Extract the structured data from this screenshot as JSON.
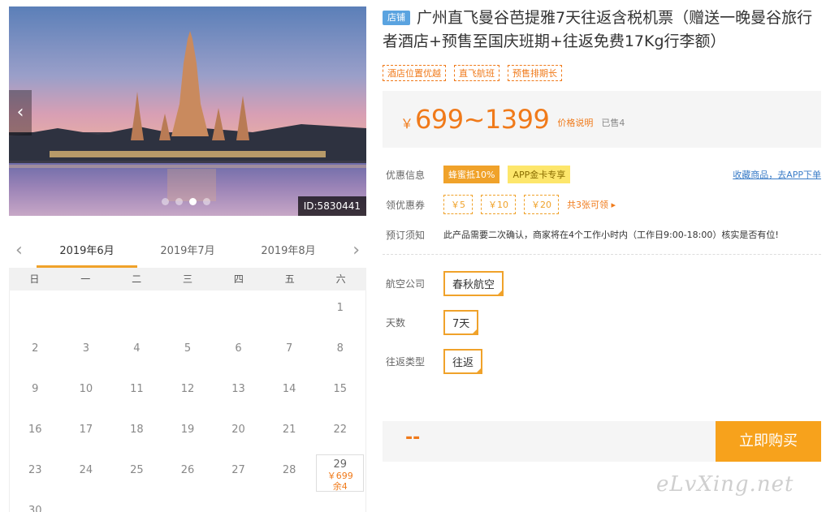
{
  "slider": {
    "prev": "‹",
    "next": "›",
    "id_badge": "ID:5830441",
    "dots": 4,
    "active_dot": 2
  },
  "calendar": {
    "prev": "‹",
    "next": "›",
    "months": [
      "2019年6月",
      "2019年7月",
      "2019年8月"
    ],
    "active_month": 0,
    "weekdays": [
      "日",
      "一",
      "二",
      "三",
      "四",
      "五",
      "六"
    ],
    "days": [
      "",
      "",
      "",
      "",
      "",
      "",
      "1",
      "2",
      "3",
      "4",
      "5",
      "6",
      "7",
      "8",
      "9",
      "10",
      "11",
      "12",
      "13",
      "14",
      "15",
      "16",
      "17",
      "18",
      "19",
      "20",
      "21",
      "22",
      "23",
      "24",
      "25",
      "26",
      "27",
      "28",
      "29",
      "30"
    ],
    "available": {
      "day": "29",
      "price": "￥699",
      "stock": "余4"
    }
  },
  "product": {
    "shop_tag": "店铺",
    "title": "广州直飞曼谷芭提雅7天往返含税机票（赠送一晚曼谷旅行者酒店+预售至国庆班期+往返免费17Kg行李额）",
    "tags": [
      "酒店位置优越",
      "直飞航班",
      "预售排期长"
    ],
    "price_currency": "￥",
    "price_range": "699~1399",
    "price_explain": "价格说明",
    "sold": "已售4"
  },
  "info": {
    "promo_label": "优惠信息",
    "honey_badge": "蜂蜜抵10%",
    "app_badge": "APP金卡专享",
    "fav_link": "收藏商品，去APP下单",
    "coupon_label": "领优惠券",
    "coupons": [
      "￥5",
      "￥10",
      "￥20"
    ],
    "coupon_more": "共3张可领",
    "coupon_more_arrow": "▸",
    "notice_label": "预订须知",
    "notice_text": "此产品需要二次确认，商家将在4个工作小时内（工作日9:00-18:00）核实是否有位!"
  },
  "options": [
    {
      "label": "航空公司",
      "value": "春秋航空"
    },
    {
      "label": "天数",
      "value": "7天"
    },
    {
      "label": "往返类型",
      "value": "往返"
    }
  ],
  "buy": {
    "total": "--",
    "button": "立即购买"
  },
  "watermark": "eLvXing.net",
  "colors": {
    "accent": "#f07a1a",
    "button": "#f7a21c",
    "shop_tag": "#5aa3e0",
    "link": "#3a7cc7"
  }
}
